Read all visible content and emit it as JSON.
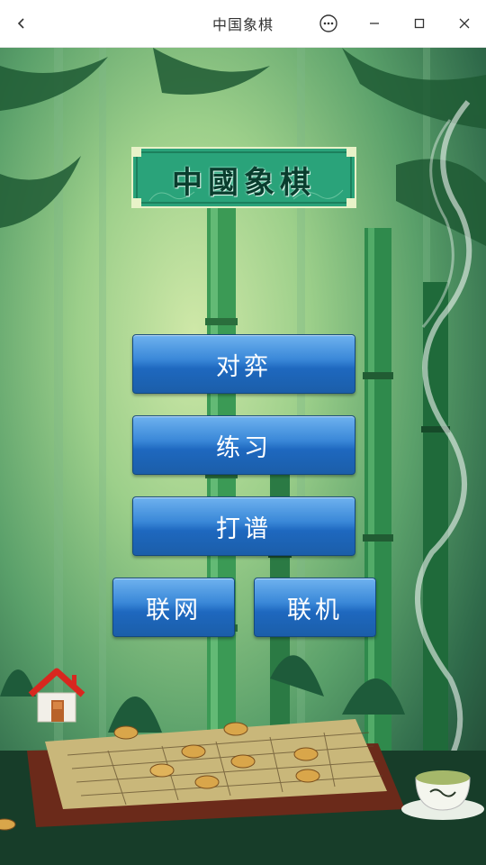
{
  "window": {
    "title": "中国象棋",
    "icons": {
      "back": "chevron-left-icon",
      "more": "more-options-icon",
      "minimize": "minimize-icon",
      "maximize": "maximize-icon",
      "close": "close-icon"
    }
  },
  "logo": {
    "text": "中國象棋"
  },
  "menu": {
    "duiyi": "对弈",
    "lianxi": "练习",
    "dapu": "打谱",
    "lianwang": "联网",
    "lianji": "联机"
  },
  "home": {
    "icon": "home-icon"
  },
  "colors": {
    "button_top": "#6fb2ef",
    "button_bottom": "#1b5ea9",
    "logo_bg": "#2aa37a"
  }
}
